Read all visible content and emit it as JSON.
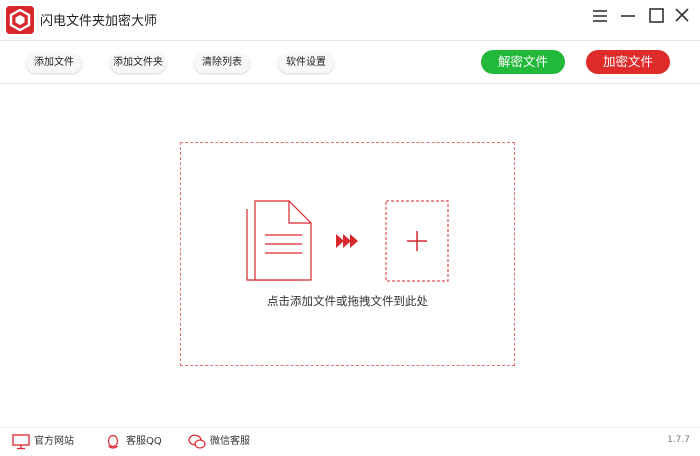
{
  "window": {
    "title": "闪电文件夹加密大师",
    "controls": [
      "menu-icon",
      "minimize-icon",
      "maximize-icon",
      "close-icon"
    ]
  },
  "toolbar": {
    "add_file": "添加文件",
    "add_folder": "添加文件夹",
    "clear_list": "清除列表",
    "settings": "软件设置",
    "decrypt": "解密文件",
    "encrypt": "加密文件"
  },
  "dropzone": {
    "hint": "点击添加文件或拖拽文件到此处",
    "icons": [
      "document-icon",
      "triple-arrow-icon",
      "plus-icon"
    ]
  },
  "statusbar": {
    "website": "官方网站",
    "support_qq": "客服QQ",
    "wechat_support": "微信客服",
    "version": "1.7.7"
  },
  "colors": {
    "brand_red": "#d9272e",
    "decrypt_green": "#22b83a",
    "encrypt_red": "#e02b2b",
    "dash_red": "#e07070"
  }
}
